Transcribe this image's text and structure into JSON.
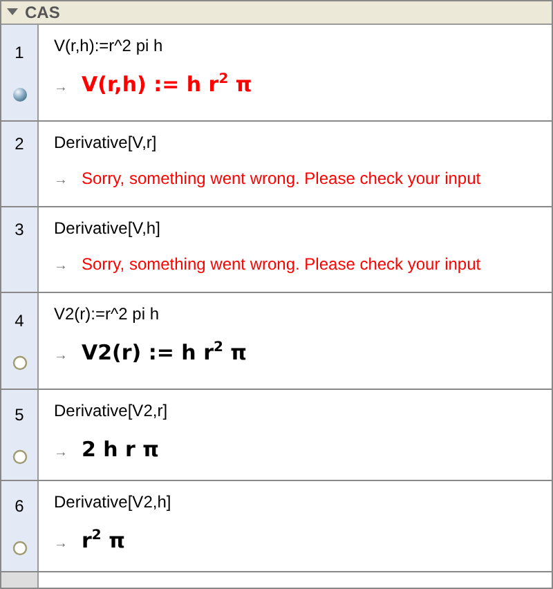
{
  "panel": {
    "title": "CAS"
  },
  "rows": [
    {
      "number": "1",
      "input": "V(r,h):=r^2 pi h",
      "kind": "math",
      "output": "V(r,h) := h r$^{2}$ π",
      "shown": true
    },
    {
      "number": "2",
      "input": "Derivative[V,r]",
      "kind": "error",
      "output": "Sorry, something went wrong. Please check your input"
    },
    {
      "number": "3",
      "input": "Derivative[V,h]",
      "kind": "error",
      "output": "Sorry, something went wrong. Please check your input"
    },
    {
      "number": "4",
      "input": "V2(r):=r^2 pi h",
      "kind": "math",
      "output": "V2(r) := h r$^{2}$ π",
      "shown": false
    },
    {
      "number": "5",
      "input": "Derivative[V2,r]",
      "kind": "math",
      "output": "2 h r π",
      "shown": false
    },
    {
      "number": "6",
      "input": "Derivative[V2,h]",
      "kind": "math",
      "output": "r$^{2}$ π",
      "shown": false
    }
  ],
  "arrow": "→"
}
